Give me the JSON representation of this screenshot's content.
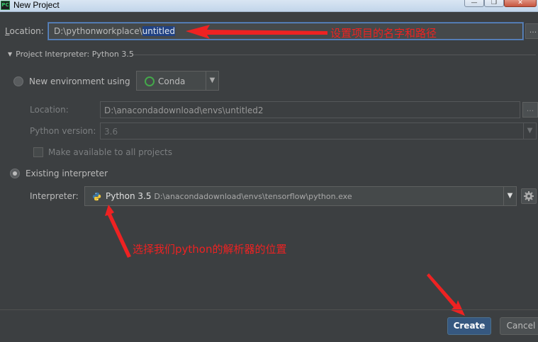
{
  "window": {
    "title": "New Project",
    "app_icon_text": "PC",
    "controls": [
      "—",
      "❐",
      "✕"
    ]
  },
  "location": {
    "label_mnemonic": "L",
    "label_rest": "ocation:",
    "value_prefix": "D:\\pythonworkplace\\",
    "value_selected": "untitled",
    "browse_label": "..."
  },
  "interpreter_section": {
    "header": "Project Interpreter: Python 3.5",
    "new_env": {
      "label": "New environment using",
      "tool": "Conda",
      "location_label": "Location:",
      "location_value": "D:\\anacondadownload\\envs\\untitled2",
      "python_version_label": "Python version:",
      "python_version_value": "3.6",
      "make_available_label": "Make available to all projects",
      "browse_label": "..."
    },
    "existing": {
      "label": "Existing interpreter",
      "interpreter_label": "Interpreter:",
      "interpreter_name": "Python 3.5",
      "interpreter_path": "D:\\anacondadownload\\envs\\tensorflow\\python.exe"
    }
  },
  "annotations": {
    "location_note": "设置项目的名字和路径",
    "interpreter_note": "选择我们python的解析器的位置"
  },
  "buttons": {
    "create": "Create",
    "cancel": "Cancel"
  },
  "colors": {
    "background": "#3c3f41",
    "annotation_red": "#ee2222",
    "primary_button": "#365880",
    "selection": "#214283"
  }
}
